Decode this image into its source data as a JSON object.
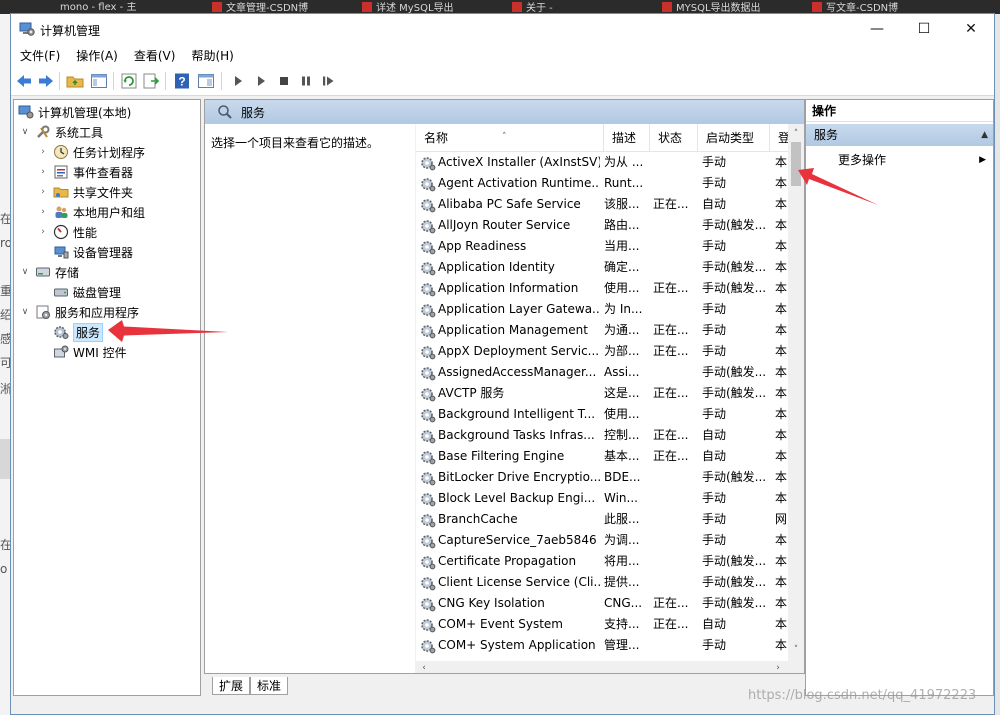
{
  "background": {
    "tabs": [
      "mono - flex - 主",
      "文章管理-CSDN博",
      "详述 MySQL导出",
      "关于 - ",
      "MYSQL导出数据出",
      "写文章-CSDN博"
    ],
    "left_fragments": [
      "在",
      "ro",
      "重",
      "绍",
      "感",
      "可",
      "淅",
      "在",
      "o"
    ]
  },
  "window": {
    "title": "计算机管理",
    "controls": {
      "minimize": "—",
      "maximize": "☐",
      "close": "✕"
    }
  },
  "menu": [
    "文件(F)",
    "操作(A)",
    "查看(V)",
    "帮助(H)"
  ],
  "tree": {
    "root": "计算机管理(本地)",
    "system_tools": "系统工具",
    "task_scheduler": "任务计划程序",
    "event_viewer": "事件查看器",
    "shared_folders": "共享文件夹",
    "local_users": "本地用户和组",
    "performance": "性能",
    "device_manager": "设备管理器",
    "storage": "存储",
    "disk_management": "磁盘管理",
    "services_apps": "服务和应用程序",
    "services": "服务",
    "wmi": "WMI 控件"
  },
  "services_panel": {
    "title": "服务",
    "description": "选择一个项目来查看它的描述。",
    "columns": {
      "name": "名称",
      "desc": "描述",
      "status": "状态",
      "startup": "启动类型",
      "logon": "登"
    },
    "rows": [
      {
        "name": "ActiveX Installer (AxInstSV)",
        "desc": "为从 ...",
        "status": "",
        "startup": "手动",
        "logon": "本"
      },
      {
        "name": "Agent Activation Runtime...",
        "desc": "Runt...",
        "status": "",
        "startup": "手动",
        "logon": "本"
      },
      {
        "name": "Alibaba PC Safe Service",
        "desc": "该服...",
        "status": "正在...",
        "startup": "自动",
        "logon": "本"
      },
      {
        "name": "AllJoyn Router Service",
        "desc": "路由...",
        "status": "",
        "startup": "手动(触发...",
        "logon": "本"
      },
      {
        "name": "App Readiness",
        "desc": "当用...",
        "status": "",
        "startup": "手动",
        "logon": "本"
      },
      {
        "name": "Application Identity",
        "desc": "确定...",
        "status": "",
        "startup": "手动(触发...",
        "logon": "本"
      },
      {
        "name": "Application Information",
        "desc": "使用...",
        "status": "正在...",
        "startup": "手动(触发...",
        "logon": "本"
      },
      {
        "name": "Application Layer Gatewa...",
        "desc": "为 In...",
        "status": "",
        "startup": "手动",
        "logon": "本"
      },
      {
        "name": "Application Management",
        "desc": "为通...",
        "status": "正在...",
        "startup": "手动",
        "logon": "本"
      },
      {
        "name": "AppX Deployment Servic...",
        "desc": "为部...",
        "status": "正在...",
        "startup": "手动",
        "logon": "本"
      },
      {
        "name": "AssignedAccessManager...",
        "desc": "Assi...",
        "status": "",
        "startup": "手动(触发...",
        "logon": "本"
      },
      {
        "name": "AVCTP 服务",
        "desc": "这是...",
        "status": "正在...",
        "startup": "手动(触发...",
        "logon": "本"
      },
      {
        "name": "Background Intelligent T...",
        "desc": "使用...",
        "status": "",
        "startup": "手动",
        "logon": "本"
      },
      {
        "name": "Background Tasks Infras...",
        "desc": "控制...",
        "status": "正在...",
        "startup": "自动",
        "logon": "本"
      },
      {
        "name": "Base Filtering Engine",
        "desc": "基本...",
        "status": "正在...",
        "startup": "自动",
        "logon": "本"
      },
      {
        "name": "BitLocker Drive Encryptio...",
        "desc": "BDE...",
        "status": "",
        "startup": "手动(触发...",
        "logon": "本"
      },
      {
        "name": "Block Level Backup Engi...",
        "desc": "Win...",
        "status": "",
        "startup": "手动",
        "logon": "本"
      },
      {
        "name": "BranchCache",
        "desc": "此服...",
        "status": "",
        "startup": "手动",
        "logon": "网"
      },
      {
        "name": "CaptureService_7aeb5846",
        "desc": "为调...",
        "status": "",
        "startup": "手动",
        "logon": "本"
      },
      {
        "name": "Certificate Propagation",
        "desc": "将用...",
        "status": "",
        "startup": "手动(触发...",
        "logon": "本"
      },
      {
        "name": "Client License Service (Cli...",
        "desc": "提供...",
        "status": "",
        "startup": "手动(触发...",
        "logon": "本"
      },
      {
        "name": "CNG Key Isolation",
        "desc": "CNG...",
        "status": "正在...",
        "startup": "手动(触发...",
        "logon": "本"
      },
      {
        "name": "COM+ Event System",
        "desc": "支持...",
        "status": "正在...",
        "startup": "自动",
        "logon": "本"
      },
      {
        "name": "COM+ System Application",
        "desc": "管理...",
        "status": "",
        "startup": "手动",
        "logon": "本"
      }
    ]
  },
  "bottom_tabs": [
    "扩展",
    "标准"
  ],
  "actions_pane": {
    "title": "操作",
    "section": "服务",
    "more": "更多操作"
  },
  "watermark": "https://blog.csdn.net/qq_41972223",
  "colors": {
    "annotation_arrow": "#e8323c",
    "selection": "#cce8ff",
    "header_blue": "#bcd0e8"
  }
}
